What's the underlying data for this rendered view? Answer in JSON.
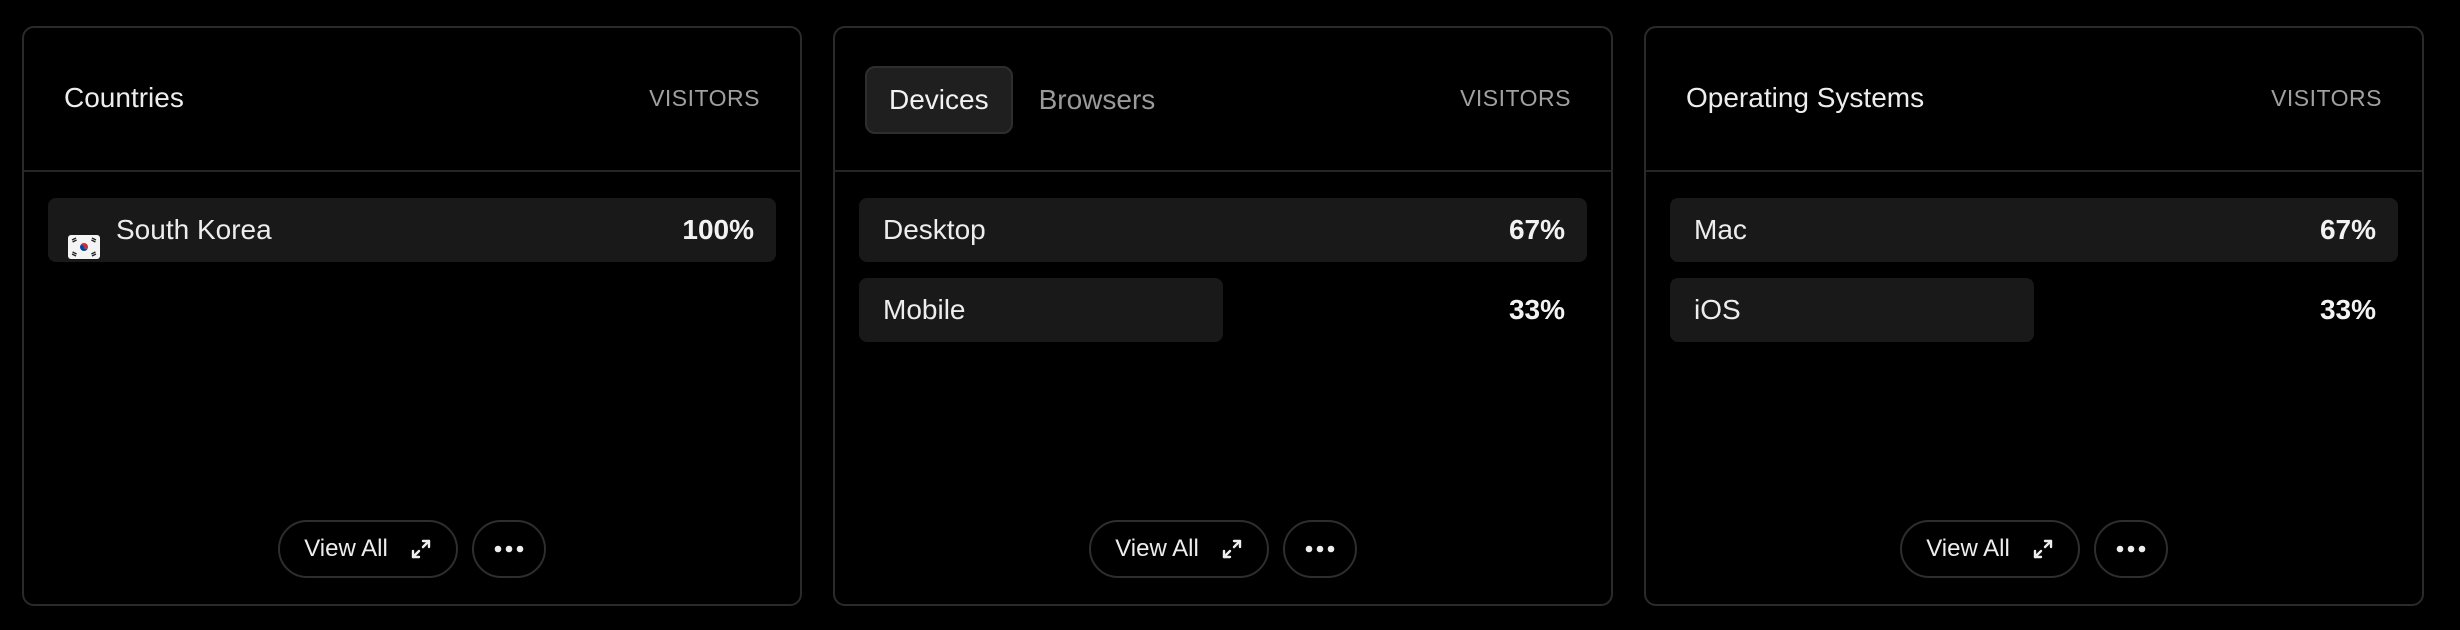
{
  "panels": [
    {
      "title": "Countries",
      "column_label": "VISITORS",
      "rows": [
        {
          "label": "South Korea",
          "value": "100%",
          "fraction": 1.0,
          "icon": "south-korea-flag-icon"
        }
      ],
      "view_all_label": "View All"
    },
    {
      "tabs": [
        {
          "label": "Devices",
          "active": true
        },
        {
          "label": "Browsers",
          "active": false
        }
      ],
      "column_label": "VISITORS",
      "rows": [
        {
          "label": "Desktop",
          "value": "67%",
          "fraction": 1.0
        },
        {
          "label": "Mobile",
          "value": "33%",
          "fraction": 0.5
        }
      ],
      "view_all_label": "View All"
    },
    {
      "title": "Operating Systems",
      "column_label": "VISITORS",
      "rows": [
        {
          "label": "Mac",
          "value": "67%",
          "fraction": 1.0
        },
        {
          "label": "iOS",
          "value": "33%",
          "fraction": 0.5
        }
      ],
      "view_all_label": "View All"
    }
  ],
  "colors": {
    "background": "#000000",
    "bar": "#191919",
    "border": "#2a2a2a",
    "muted_text": "#a0a0a0"
  },
  "icons": {
    "expand": "expand-arrows-icon",
    "more": "more-horizontal-icon"
  }
}
